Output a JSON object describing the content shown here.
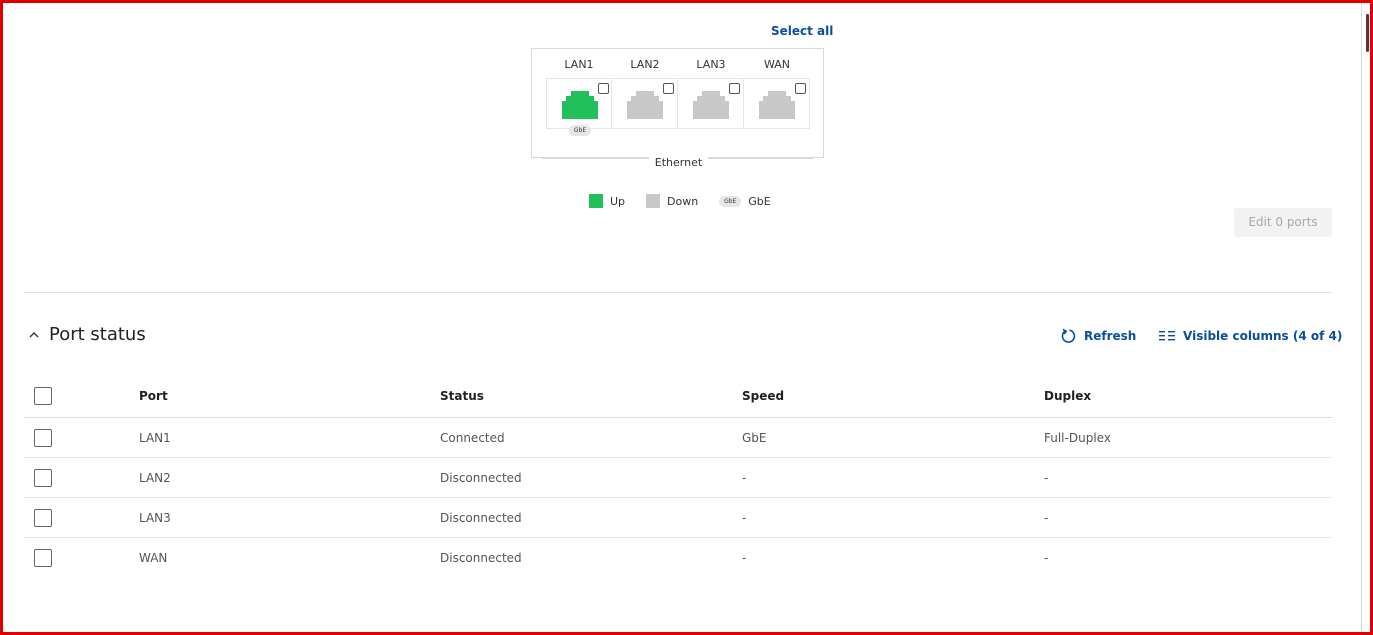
{
  "port_selector": {
    "select_all_label": "Select all",
    "ports": [
      {
        "name": "LAN1",
        "state": "up",
        "badge": "GbE"
      },
      {
        "name": "LAN2",
        "state": "down",
        "badge": ""
      },
      {
        "name": "LAN3",
        "state": "down",
        "badge": ""
      },
      {
        "name": "WAN",
        "state": "down",
        "badge": ""
      }
    ],
    "group_label": "Ethernet"
  },
  "legend": {
    "up_label": "Up",
    "down_label": "Down",
    "gbe_badge": "GbE",
    "gbe_label": "GbE"
  },
  "edit_button_label": "Edit 0 ports",
  "port_status": {
    "title": "Port status",
    "refresh_label": "Refresh",
    "visible_columns_label": "Visible columns (4 of 4)",
    "columns": [
      "Port",
      "Status",
      "Speed",
      "Duplex"
    ],
    "rows": [
      [
        "LAN1",
        "Connected",
        "GbE",
        "Full-Duplex"
      ],
      [
        "LAN2",
        "Disconnected",
        "-",
        "-"
      ],
      [
        "LAN3",
        "Disconnected",
        "-",
        "-"
      ],
      [
        "WAN",
        "Disconnected",
        "-",
        "-"
      ]
    ]
  },
  "colors": {
    "up": "#22c05a",
    "down": "#c8c8c8",
    "link": "#0b4e9c",
    "frame": "#e00000"
  }
}
